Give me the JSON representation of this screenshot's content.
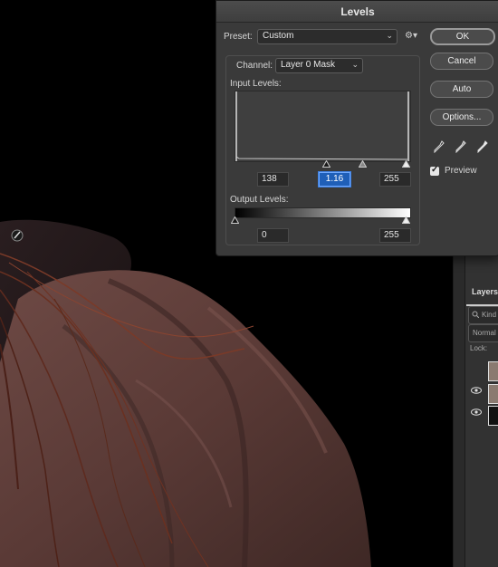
{
  "dialog": {
    "title": "Levels",
    "preset_label": "Preset:",
    "preset_value": "Custom",
    "channel_label": "Channel:",
    "channel_value": "Layer 0 Mask",
    "input_levels_label": "Input Levels:",
    "input_black": "138",
    "input_gamma": "1.16",
    "input_white": "255",
    "output_levels_label": "Output Levels:",
    "output_black": "0",
    "output_white": "255",
    "buttons": {
      "ok": "OK",
      "cancel": "Cancel",
      "auto": "Auto",
      "options": "Options..."
    },
    "preview_label": "Preview",
    "preview_checked": true
  },
  "layers_panel": {
    "tab_label": "Layers",
    "kind_placeholder": "Kind",
    "blend_mode": "Normal",
    "lock_label": "Lock:"
  },
  "icons": {
    "gear": "gear-icon",
    "black_eyedropper": "eyedropper-black-icon",
    "gray_eyedropper": "eyedropper-gray-icon",
    "white_eyedropper": "eyedropper-white-icon",
    "visibility": "eye-icon"
  },
  "colors": {
    "accent": "#1f5fb8",
    "dialog_bg": "#3a3a3a"
  }
}
